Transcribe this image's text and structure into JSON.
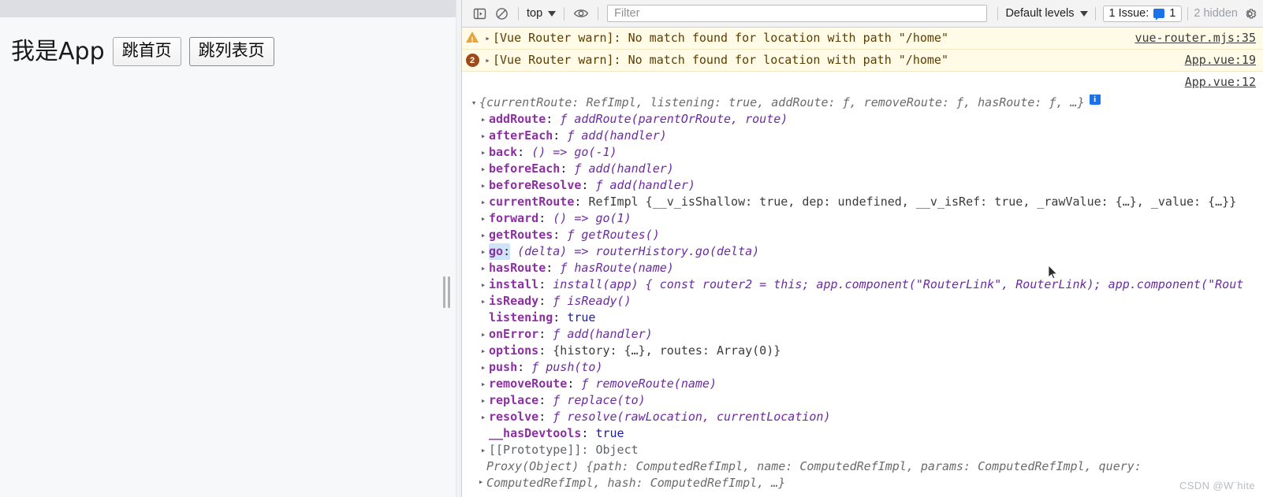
{
  "left_pane": {
    "app_title": "我是App",
    "buttons": [
      {
        "label": "跳首页"
      },
      {
        "label": "跳列表页"
      }
    ]
  },
  "devtools": {
    "toolbar": {
      "sidebar_toggle_icon": "sidebar-panel-icon",
      "clear_console_icon": "clear-console-icon",
      "context_label": "top",
      "context_caret_icon": "chevron-down-icon",
      "live_expression_icon": "eye-icon",
      "filter_placeholder": "Filter",
      "filter_value": "",
      "levels_label": "Default levels",
      "levels_caret_icon": "chevron-down-icon",
      "issues_label": "1 Issue:",
      "issues_chip_icon": "issue-chip-icon",
      "issues_count": "1",
      "hidden_label": "2 hidden",
      "settings_icon": "gear-icon"
    },
    "messages": [
      {
        "icon": "warning-triangle-icon",
        "badge": "",
        "expander": "▸",
        "text": "[Vue Router warn]: No match found for location with path \"/home\"",
        "source": "vue-router.mjs:35"
      },
      {
        "icon": "repeat-count-badge",
        "badge": "2",
        "expander": "▸",
        "text": "[Vue Router warn]: No match found for location with path \"/home\"",
        "source": "App.vue:19"
      }
    ],
    "trailing_source": "App.vue:12",
    "inspector": {
      "header": {
        "expander": "▾",
        "text": "{currentRoute: RefImpl, listening: true, addRoute: ƒ, removeRoute: ƒ, hasRoute: ƒ, …}",
        "parts": {
          "open": "{",
          "k1": "currentRoute: ",
          "v1": "RefImpl, ",
          "k2": "listening: ",
          "v2": "true",
          "k3": ", addRoute: ",
          "v3": "ƒ",
          "k4": ", removeRoute: ",
          "v4": "ƒ",
          "k5": ", hasRoute: ",
          "v5": "ƒ",
          "k6": ", …}"
        },
        "info_badge": "i"
      },
      "rows": [
        {
          "expander": "▸",
          "key": "addRoute",
          "colon": ":",
          "fnchar": "ƒ",
          "value": "addRoute(parentOrRoute, route)",
          "style": "fn",
          "selected": false
        },
        {
          "expander": "▸",
          "key": "afterEach",
          "colon": ":",
          "fnchar": "ƒ",
          "value": "add(handler)",
          "style": "fn",
          "selected": false
        },
        {
          "expander": "▸",
          "key": "back",
          "colon": ":",
          "fnchar": "",
          "value": "() => go(-1)",
          "style": "fn",
          "selected": false
        },
        {
          "expander": "▸",
          "key": "beforeEach",
          "colon": ":",
          "fnchar": "ƒ",
          "value": "add(handler)",
          "style": "fn",
          "selected": false
        },
        {
          "expander": "▸",
          "key": "beforeResolve",
          "colon": ":",
          "fnchar": "ƒ",
          "value": "add(handler)",
          "style": "fn",
          "selected": false
        },
        {
          "expander": "▸",
          "key": "currentRoute",
          "colon": ":",
          "fnchar": "",
          "value": "RefImpl {__v_isShallow: true, dep: undefined, __v_isRef: true, _rawValue: {…}, _value: {…}}",
          "style": "obj",
          "selected": false
        },
        {
          "expander": "▸",
          "key": "forward",
          "colon": ":",
          "fnchar": "",
          "value": "() => go(1)",
          "style": "fn",
          "selected": false
        },
        {
          "expander": "▸",
          "key": "getRoutes",
          "colon": ":",
          "fnchar": "ƒ",
          "value": "getRoutes()",
          "style": "fn",
          "selected": false
        },
        {
          "expander": "▸",
          "key": "go",
          "colon": ":",
          "fnchar": "",
          "value": "(delta) => routerHistory.go(delta)",
          "style": "fn",
          "selected": true
        },
        {
          "expander": "▸",
          "key": "hasRoute",
          "colon": ":",
          "fnchar": "ƒ",
          "value": "hasRoute(name)",
          "style": "fn",
          "selected": false
        },
        {
          "expander": "▸",
          "key": "install",
          "colon": ":",
          "fnchar": "",
          "value": "install(app) { const router2 = this; app.component(\"RouterLink\", RouterLink); app.component(\"Rout",
          "style": "fn",
          "selected": false
        },
        {
          "expander": "▸",
          "key": "isReady",
          "colon": ":",
          "fnchar": "ƒ",
          "value": "isReady()",
          "style": "fn",
          "selected": false
        },
        {
          "expander": "",
          "key": "listening",
          "colon": ":",
          "fnchar": "",
          "value": "true",
          "style": "kw",
          "selected": false
        },
        {
          "expander": "▸",
          "key": "onError",
          "colon": ":",
          "fnchar": "ƒ",
          "value": "add(handler)",
          "style": "fn",
          "selected": false
        },
        {
          "expander": "▸",
          "key": "options",
          "colon": ":",
          "fnchar": "",
          "value": "{history: {…}, routes: Array(0)}",
          "style": "obj",
          "selected": false
        },
        {
          "expander": "▸",
          "key": "push",
          "colon": ":",
          "fnchar": "ƒ",
          "value": "push(to)",
          "style": "fn",
          "selected": false
        },
        {
          "expander": "▸",
          "key": "removeRoute",
          "colon": ":",
          "fnchar": "ƒ",
          "value": "removeRoute(name)",
          "style": "fn",
          "selected": false
        },
        {
          "expander": "▸",
          "key": "replace",
          "colon": ":",
          "fnchar": "ƒ",
          "value": "replace(to)",
          "style": "fn",
          "selected": false
        },
        {
          "expander": "▸",
          "key": "resolve",
          "colon": ":",
          "fnchar": "ƒ",
          "value": "resolve(rawLocation, currentLocation)",
          "style": "fn",
          "selected": false
        },
        {
          "expander": "",
          "key": "__hasDevtools",
          "colon": ":",
          "fnchar": "",
          "value": "true",
          "style": "kw",
          "selected": false
        }
      ],
      "prototype_row": {
        "expander": "▸",
        "label": "[[Prototype]]: Object"
      },
      "proxy_row": {
        "expander": "▸",
        "text": "Proxy(Object) {path: ComputedRefImpl, name: ComputedRefImpl, params: ComputedRefImpl, query: ComputedRefImpl, hash: ComputedRefImpl, …}"
      }
    },
    "watermark": "CSDN @W¨hite"
  },
  "colors": {
    "warn_bg": "#fffbe6",
    "accent_blue": "#1a73e8",
    "prop_purple": "#8b2fa1",
    "fn_purple": "#6c2ba0",
    "keyword_blue": "#1a1aa6",
    "toolbar_bg": "#f3f3f3"
  }
}
